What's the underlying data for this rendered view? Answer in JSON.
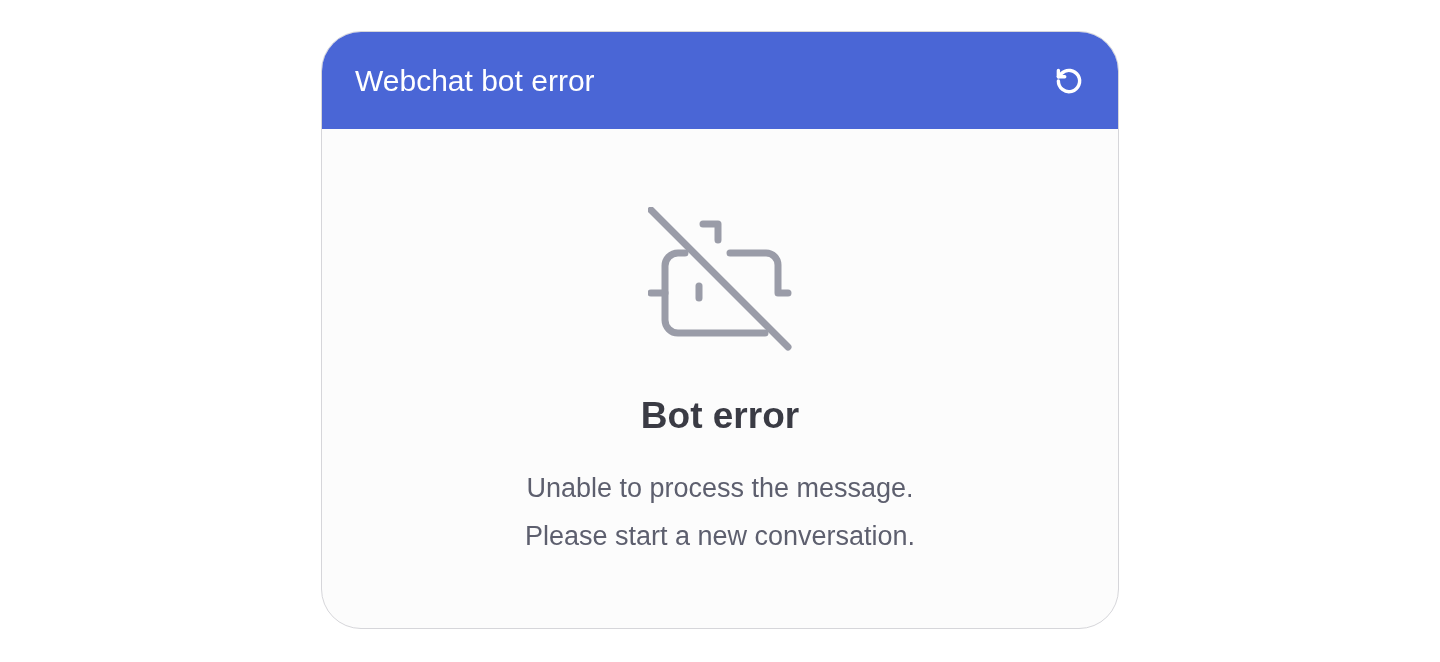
{
  "window": {
    "title": "Webchat bot error"
  },
  "error": {
    "heading": "Bot error",
    "lines": [
      "Unable to process the message.",
      "Please start a new conversation."
    ]
  }
}
